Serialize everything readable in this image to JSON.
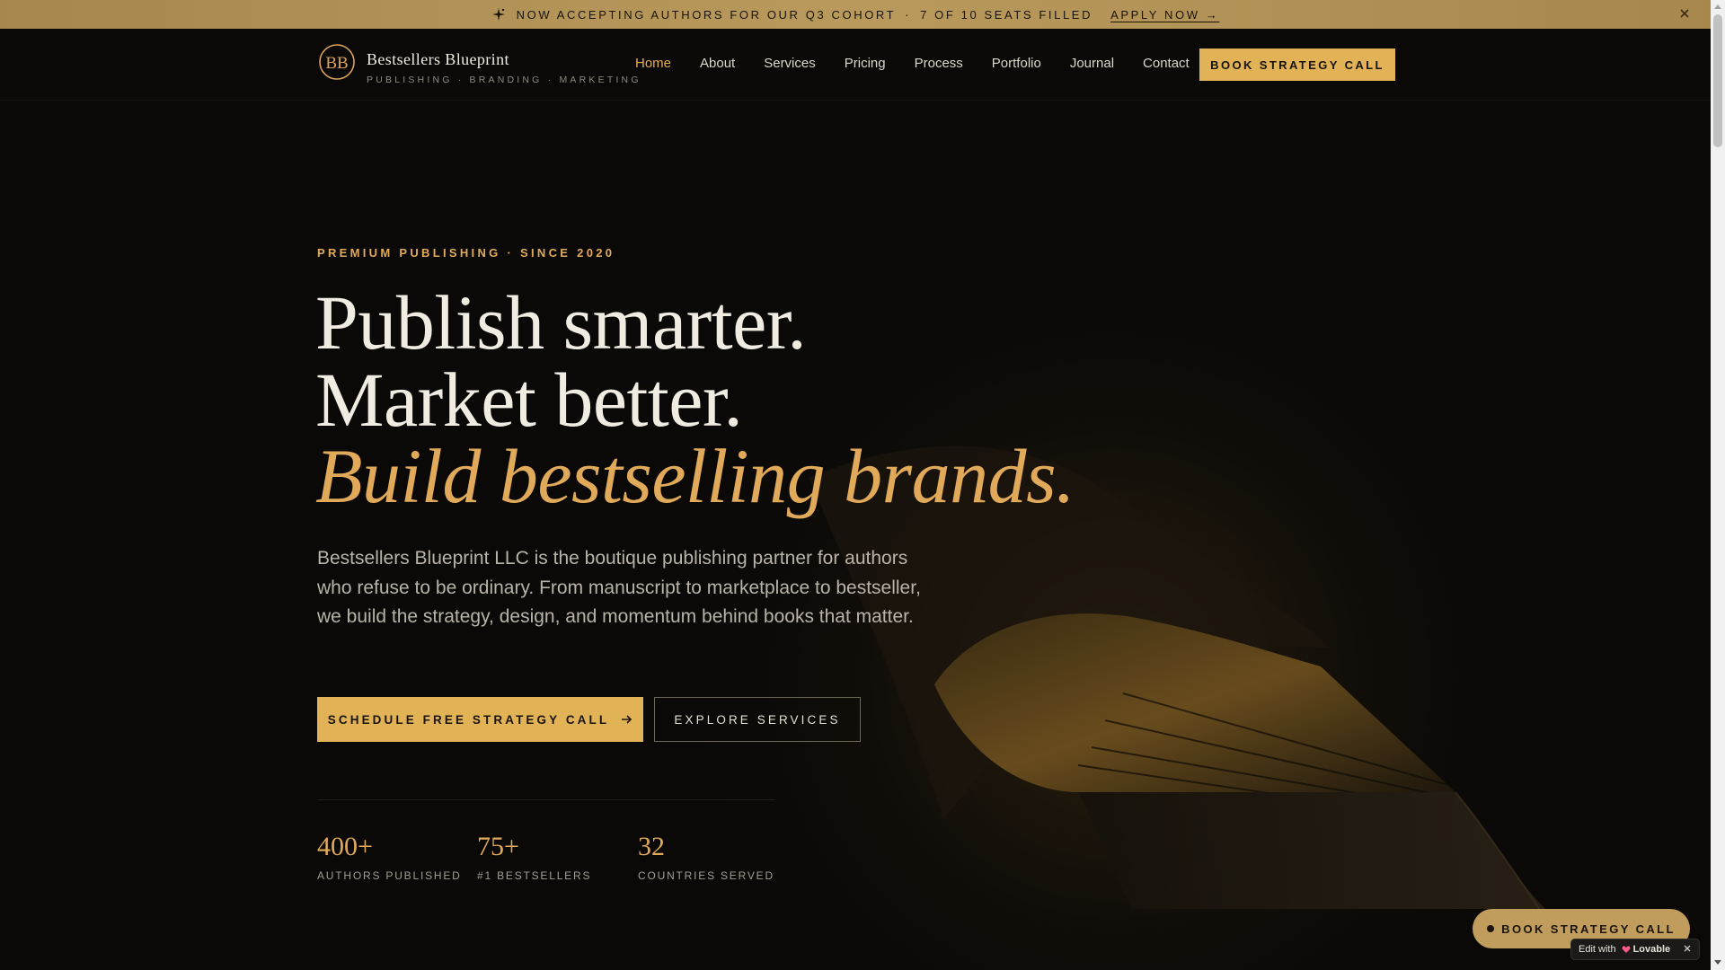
{
  "announcement": {
    "icon": "sparkle-icon",
    "text": "NOW ACCEPTING AUTHORS FOR OUR Q3 COHORT",
    "separator": "·",
    "seats": "7 OF 10 SEATS FILLED",
    "apply_label": "APPLY NOW →",
    "close_icon": "close-icon"
  },
  "brand": {
    "name": "Bestsellers Blueprint",
    "tagline": "PUBLISHING · BRANDING · MARKETING",
    "logo_icon": "bb-monogram-icon"
  },
  "nav": {
    "items": [
      {
        "label": "Home",
        "active": true
      },
      {
        "label": "About",
        "active": false
      },
      {
        "label": "Services",
        "active": false
      },
      {
        "label": "Pricing",
        "active": false
      },
      {
        "label": "Process",
        "active": false
      },
      {
        "label": "Portfolio",
        "active": false
      },
      {
        "label": "Journal",
        "active": false
      },
      {
        "label": "Contact",
        "active": false
      }
    ],
    "cta_label": "BOOK STRATEGY CALL"
  },
  "hero": {
    "eyebrow": "PREMIUM PUBLISHING · SINCE 2020",
    "headline_1": "Publish smarter.",
    "headline_2": "Market better.",
    "headline_3": "Build bestselling brands.",
    "lead": "Bestsellers Blueprint LLC is the boutique publishing partner for authors who refuse to be ordinary. From manuscript to marketplace to bestseller, we build the strategy, design, and momentum behind books that matter.",
    "primary_cta": "SCHEDULE FREE STRATEGY CALL",
    "secondary_cta": "EXPLORE SERVICES"
  },
  "stats": [
    {
      "value": "400+",
      "label": "AUTHORS PUBLISHED"
    },
    {
      "value": "75+",
      "label": "#1 BESTSELLERS"
    },
    {
      "value": "32",
      "label": "COUNTRIES SERVED"
    }
  ],
  "floating": {
    "cta_label": "BOOK STRATEGY CALL",
    "lovable_prefix": "Edit with",
    "lovable_name": "Lovable"
  },
  "colors": {
    "accent_gold": "#e2b257",
    "background": "#0a0908",
    "announcement_bar": "#b99a5c"
  }
}
